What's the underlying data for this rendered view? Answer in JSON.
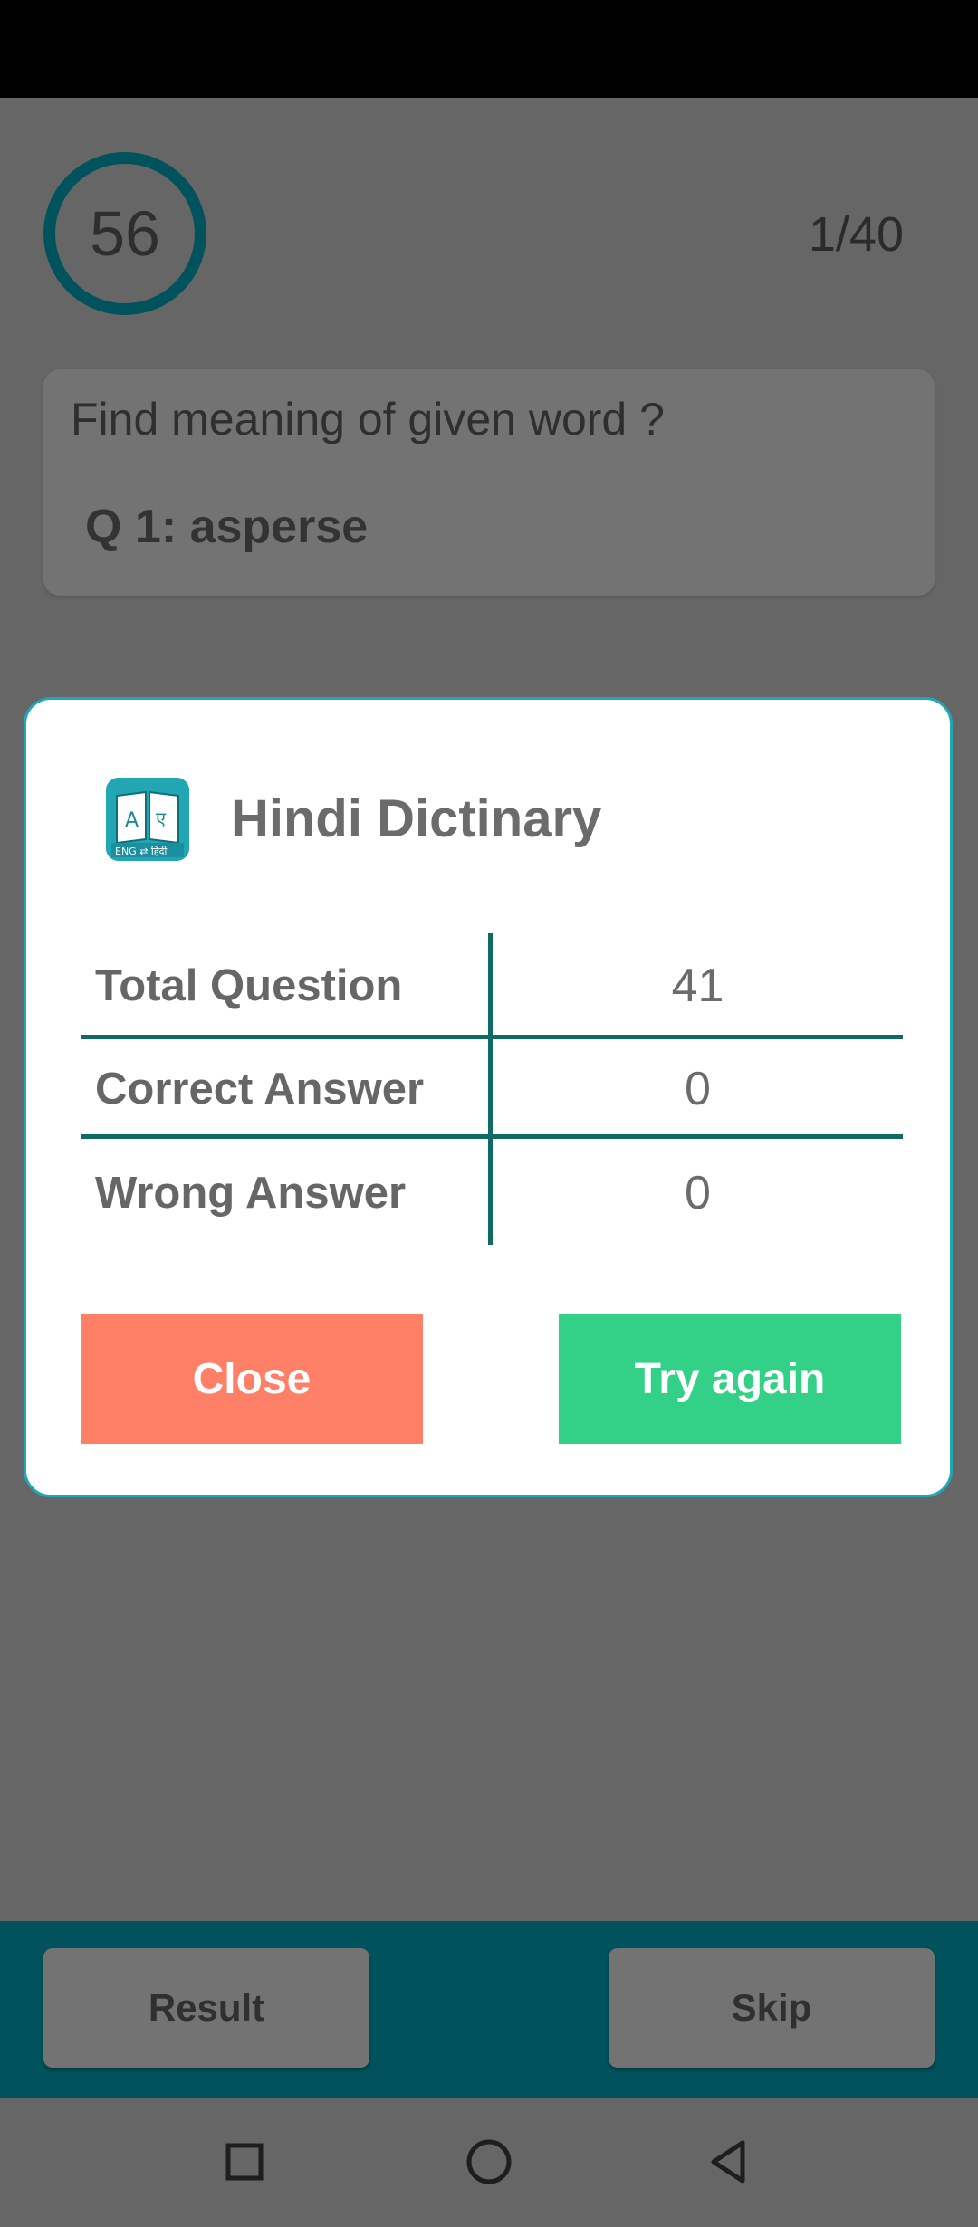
{
  "quiz": {
    "timer": "56",
    "progress": "1/40",
    "prompt": "Find meaning of given word ?",
    "question": "Q 1: asperse"
  },
  "dialog": {
    "title": "Hindi Dictinary",
    "icon": "book-app-icon",
    "stats": [
      {
        "label": "Total Question",
        "value": "41"
      },
      {
        "label": "Correct Answer",
        "value": "0"
      },
      {
        "label": "Wrong Answer",
        "value": "0"
      }
    ],
    "close_label": "Close",
    "try_again_label": "Try again"
  },
  "actions": {
    "result_label": "Result",
    "skip_label": "Skip"
  },
  "nav": {
    "recent_icon": "square-icon",
    "home_icon": "circle-icon",
    "back_icon": "triangle-back-icon"
  },
  "colors": {
    "accent": "#00535c",
    "close": "#ff8066",
    "try_again": "#33d188",
    "table_lines": "#0f6b62",
    "dialog_border": "#1fa7b6"
  }
}
